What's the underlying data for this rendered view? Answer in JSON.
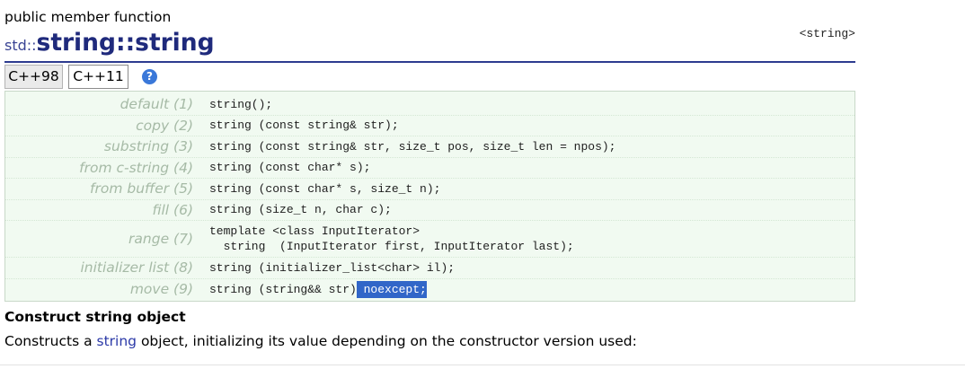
{
  "header": {
    "member_type": "public member function",
    "namespace": "std::",
    "name": "string::string",
    "header_file": "<string>"
  },
  "tabs": [
    {
      "label": "C++98",
      "active": false
    },
    {
      "label": "C++11",
      "active": true
    }
  ],
  "help": {
    "icon": "help-icon",
    "glyph": "?"
  },
  "prototypes": [
    {
      "label": "default (1)",
      "code": [
        "string();"
      ]
    },
    {
      "label": "copy (2)",
      "code": [
        "string (const string& str);"
      ]
    },
    {
      "label": "substring (3)",
      "code": [
        "string (const string& str, size_t pos, size_t len = npos);"
      ]
    },
    {
      "label": "from c-string (4)",
      "code": [
        "string (const char* s);"
      ]
    },
    {
      "label": "from buffer (5)",
      "code": [
        "string (const char* s, size_t n);"
      ]
    },
    {
      "label": "fill (6)",
      "code": [
        "string (size_t n, char c);"
      ]
    },
    {
      "label": "range (7)",
      "code": [
        "template <class InputIterator>",
        "  string  (InputIterator first, InputIterator last);"
      ]
    },
    {
      "label": "initializer list (8)",
      "code": [
        "string (initializer_list<char> il);"
      ]
    },
    {
      "label": "move (9)",
      "code": [
        "string (string&& str)"
      ],
      "selected_text": " noexcept;"
    }
  ],
  "description": {
    "heading": "Construct string object",
    "text_before": "Constructs a ",
    "link_text": "string",
    "text_after": " object, initializing its value depending on the constructor version used:"
  },
  "colors": {
    "title_blue": "#1f2a7c",
    "namespace_blue": "#3a4494",
    "title_rule": "#2d3b8f",
    "help_blue": "#3a78d9",
    "table_bg": "#f1faf1",
    "table_border": "#c8d8c8",
    "row_rule": "#d4e7d4",
    "label_gray": "#a6baa6",
    "selection_blue": "#3166c8",
    "link_blue": "#2c3aa8"
  }
}
